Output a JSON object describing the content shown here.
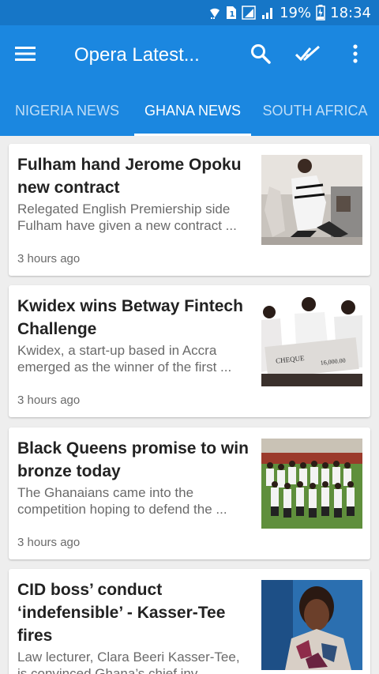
{
  "status_bar": {
    "battery_percent": "19%",
    "time": "18:34",
    "icons": [
      "wifi-icon",
      "sim-1-icon",
      "data-signal-icon",
      "cell-signal-icon",
      "battery-icon"
    ]
  },
  "app_bar": {
    "title": "Opera Latest...",
    "icons": [
      "menu-icon",
      "search-icon",
      "mark-all-read-icon",
      "more-vert-icon"
    ]
  },
  "colors": {
    "app_bar": "#1b87e0",
    "status_bar": "#1676c7",
    "background": "#eeeeee"
  },
  "tabs": [
    {
      "label": "NIGERIA NEWS",
      "active": false
    },
    {
      "label": "GHANA NEWS",
      "active": true
    },
    {
      "label": "SOUTH AFRICA",
      "active": false
    }
  ],
  "articles": [
    {
      "title": "Fulham hand Jerome Opoku new contract",
      "summary": "Relegated English Premiership side Fulham have given a new contract ...",
      "time": "3 hours ago"
    },
    {
      "title": "Kwidex wins Betway Fintech Challenge",
      "summary": "Kwidex, a start-up based in Accra emerged as the winner of the first ...",
      "time": "3 hours ago"
    },
    {
      "title": "Black Queens promise to win bronze today",
      "summary": "The Ghanaians came into the competition hoping to defend the ...",
      "time": "3 hours ago"
    },
    {
      "title": "CID boss’ conduct ‘indefensible’ - Kasser-Tee fires",
      "summary": "Law lecturer, Clara Beeri Kasser-Tee, is convinced Ghana’s chief inv...",
      "time": ""
    }
  ]
}
